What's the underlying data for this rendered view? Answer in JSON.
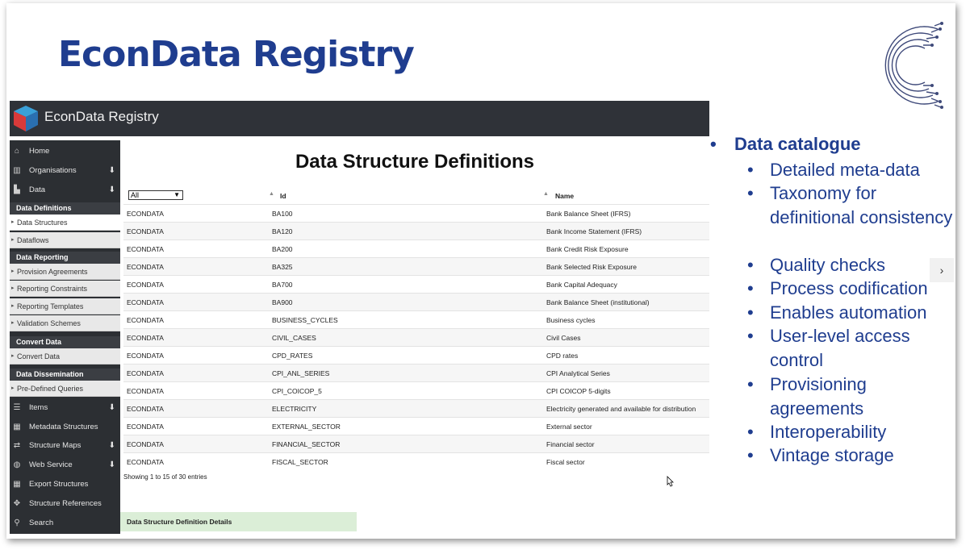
{
  "slide": {
    "title": "EconData Registry",
    "next_arrow": "›",
    "bullets": {
      "heading": "Data catalogue",
      "items": [
        "Detailed meta-data",
        "Taxonomy for definitional consistency",
        "Quality checks",
        "Process codification",
        "Enables automation",
        "User-level access control",
        "Provisioning agreements",
        "Interoperability",
        "Vintage storage"
      ]
    }
  },
  "app": {
    "title": "EconData Registry",
    "sidebar": {
      "home": "Home",
      "organisations": "Organisations",
      "data": "Data",
      "data_definitions": "Data Definitions",
      "data_structures": "Data Structures",
      "dataflows": "Dataflows",
      "data_reporting": "Data Reporting",
      "provision_agreements": "Provision Agreements",
      "reporting_constraints": "Reporting Constraints",
      "reporting_templates": "Reporting Templates",
      "validation_schemes": "Validation Schemes",
      "convert_data_head": "Convert Data",
      "convert_data": "Convert Data",
      "data_dissemination": "Data Dissemination",
      "predefined_queries": "Pre-Defined Queries",
      "items": "Items",
      "metadata_structures": "Metadata Structures",
      "structure_maps": "Structure Maps",
      "web_service": "Web Service",
      "export_structures": "Export Structures",
      "structure_references": "Structure References",
      "search": "Search"
    },
    "main": {
      "title": "Data Structure Definitions",
      "filter_value": "All",
      "columns": [
        "Id",
        "Name"
      ],
      "rows": [
        [
          "ECONDATA",
          "BA100",
          "Bank Balance Sheet (IFRS)"
        ],
        [
          "ECONDATA",
          "BA120",
          "Bank Income Statement (IFRS)"
        ],
        [
          "ECONDATA",
          "BA200",
          "Bank Credit Risk Exposure"
        ],
        [
          "ECONDATA",
          "BA325",
          "Bank Selected Risk Exposure"
        ],
        [
          "ECONDATA",
          "BA700",
          "Bank Capital Adequacy"
        ],
        [
          "ECONDATA",
          "BA900",
          "Bank Balance Sheet (institutional)"
        ],
        [
          "ECONDATA",
          "BUSINESS_CYCLES",
          "Business cycles"
        ],
        [
          "ECONDATA",
          "CIVIL_CASES",
          "Civil Cases"
        ],
        [
          "ECONDATA",
          "CPD_RATES",
          "CPD rates"
        ],
        [
          "ECONDATA",
          "CPI_ANL_SERIES",
          "CPI Analytical Series"
        ],
        [
          "ECONDATA",
          "CPI_COICOP_5",
          "CPI COICOP 5-digits"
        ],
        [
          "ECONDATA",
          "ELECTRICITY",
          "Electricity generated and available for distribution"
        ],
        [
          "ECONDATA",
          "EXTERNAL_SECTOR",
          "External sector"
        ],
        [
          "ECONDATA",
          "FINANCIAL_SECTOR",
          "Financial sector"
        ],
        [
          "ECONDATA",
          "FISCAL_SECTOR",
          "Fiscal sector"
        ]
      ],
      "showing": "Showing 1 to 15 of 30 entries",
      "details": "Data Structure Definition Details"
    }
  },
  "colors": {
    "title_blue": "#1f3d8f",
    "sidebar_bg": "#2c2f33",
    "details_green": "#dbeed7"
  }
}
